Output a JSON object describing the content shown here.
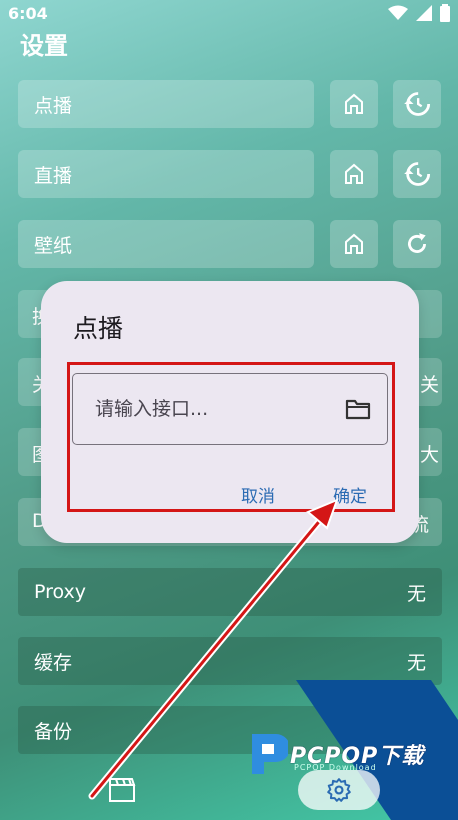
{
  "status_bar": {
    "time": "6:04"
  },
  "page_title": "设置",
  "rows": [
    {
      "label": "点播"
    },
    {
      "label": "直播"
    },
    {
      "label": "壁纸"
    }
  ],
  "peek_texts": {
    "r4_left": "换",
    "r5_left": "关",
    "r5_right": "关",
    "r6_left": "图",
    "r6_right": "大",
    "r7_left": "D",
    "r7_right": "流"
  },
  "settings": [
    {
      "label": "Proxy",
      "value": "无"
    },
    {
      "label": "缓存",
      "value": "无"
    },
    {
      "label": "备份",
      "value": ""
    }
  ],
  "dialog": {
    "title": "点播",
    "input_placeholder": "请输入接口...",
    "cancel": "取消",
    "confirm": "确定"
  },
  "watermark": {
    "brand": "PCPOP下载",
    "sub": "PCPOP Download"
  },
  "colors": {
    "accent": "#2b6bb3",
    "highlight": "#d41616",
    "dialog_bg": "#ece7f1"
  }
}
